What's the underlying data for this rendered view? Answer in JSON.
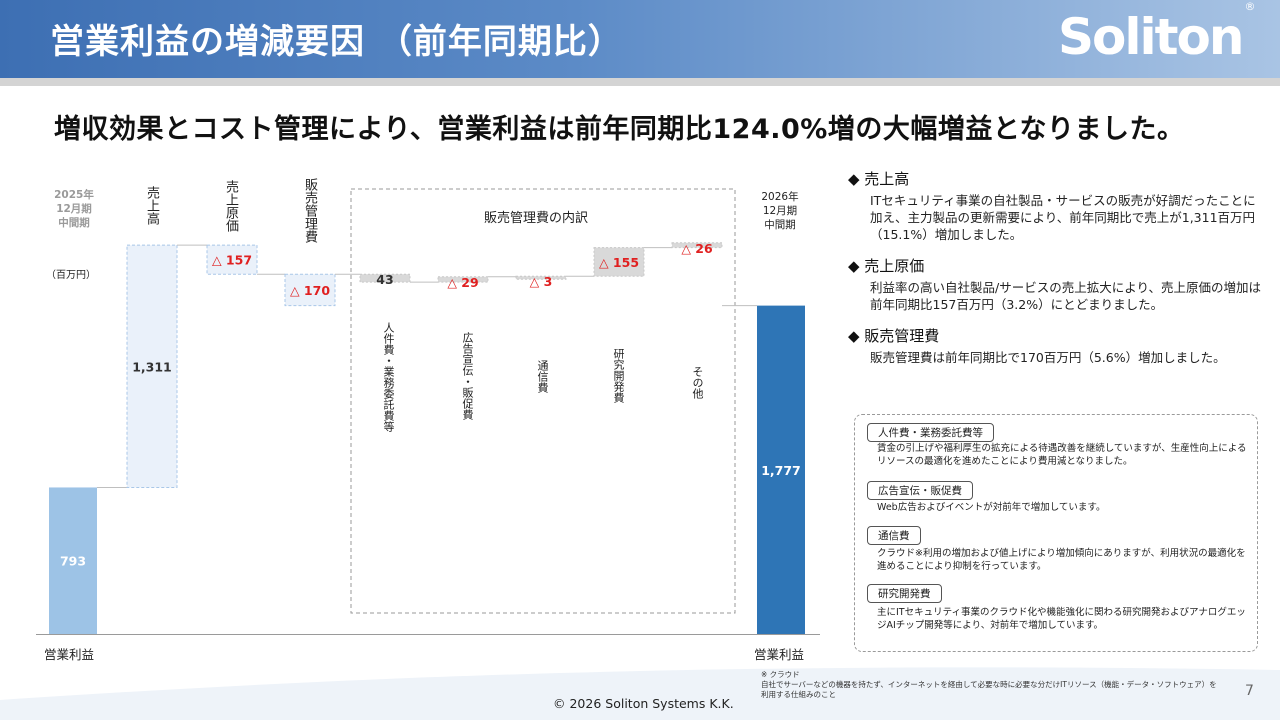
{
  "header": {
    "title": "営業利益の増減要因 （前年同期比）",
    "logo": "Soliton",
    "logo_mark": "®"
  },
  "headline": "増収効果とコスト管理により、営業利益は前年同期比124.0%増の大幅増益となりました。",
  "chart_data": {
    "type": "waterfall",
    "unit_label": "（百万円）",
    "start": {
      "period": [
        "2025年",
        "12月期",
        "中間期"
      ],
      "label": "営業利益",
      "value": 793,
      "value_label": "793"
    },
    "steps": [
      {
        "label": "売上高",
        "value": 1311,
        "value_label": "1,311",
        "direction": "up"
      },
      {
        "label": "売上原価",
        "value": -157,
        "value_label": "△ 157",
        "direction": "down"
      },
      {
        "label": "販売管理費",
        "value": -170,
        "value_label": "△ 170",
        "direction": "down"
      }
    ],
    "breakdown": {
      "title": "販売管理費の内訳",
      "items": [
        {
          "label": "人件費・業務委託費等",
          "value": 43,
          "value_label": "43"
        },
        {
          "label": "広告宣伝・販促費",
          "value": -29,
          "value_label": "△ 29"
        },
        {
          "label": "通信費",
          "value": -3,
          "value_label": "△ 3"
        },
        {
          "label": "研究開発費",
          "value": -155,
          "value_label": "△ 155"
        },
        {
          "label": "その他",
          "value": -26,
          "value_label": "△ 26"
        }
      ]
    },
    "end": {
      "period": [
        "2026年",
        "12月期",
        "中間期"
      ],
      "label": "営業利益",
      "value": 1777,
      "value_label": "1,777"
    },
    "colors": {
      "start_bar": "#9dc3e6",
      "end_bar": "#2e75b6",
      "step_fill": "#eaf1fa",
      "negative_text": "#e02020",
      "breakdown_fill": "#d9d9d9"
    }
  },
  "right": {
    "sections": [
      {
        "title": "◆ 売上高",
        "body": "ITセキュリティ事業の自社製品・サービスの販売が好調だったことに加え、主力製品の更新需要により、前年同期比で売上が1,311百万円（15.1%）増加しました。"
      },
      {
        "title": "◆ 売上原価",
        "body": "利益率の高い自社製品/サービスの売上拡大により、売上原価の増加は前年同期比157百万円（3.2%）にとどまりました。"
      },
      {
        "title": "◆ 販売管理費",
        "body": "販売管理費は前年同期比で170百万円（5.6%）増加しました。"
      }
    ],
    "details": [
      {
        "tag": "人件費・業務委託費等",
        "text": "賃金の引上げや福利厚生の拡充による待遇改善を継続していますが、生産性向上によるリソースの最適化を進めたことにより費用減となりました。"
      },
      {
        "tag": "広告宣伝・販促費",
        "text": "Web広告およびイベントが対前年で増加しています。"
      },
      {
        "tag": "通信費",
        "text": "クラウド※利用の増加および値上げにより増加傾向にありますが、利用状況の最適化を進めることにより抑制を行っています。"
      },
      {
        "tag": "研究開発費",
        "text": "主にITセキュリティ事業のクラウド化や機能強化に関わる研究開発およびアナログエッジAIチップ開発等により、対前年で増加しています。"
      }
    ]
  },
  "footnote": {
    "line1": "※ クラウド",
    "line2": "自社でサーバーなどの機器を持たず、インターネットを経由して必要な時に必要な分だけITリソース（機能・データ・ソフトウェア）を利用する仕組みのこと"
  },
  "copyright": "© 2026 Soliton Systems K.K.",
  "page_number": "7"
}
